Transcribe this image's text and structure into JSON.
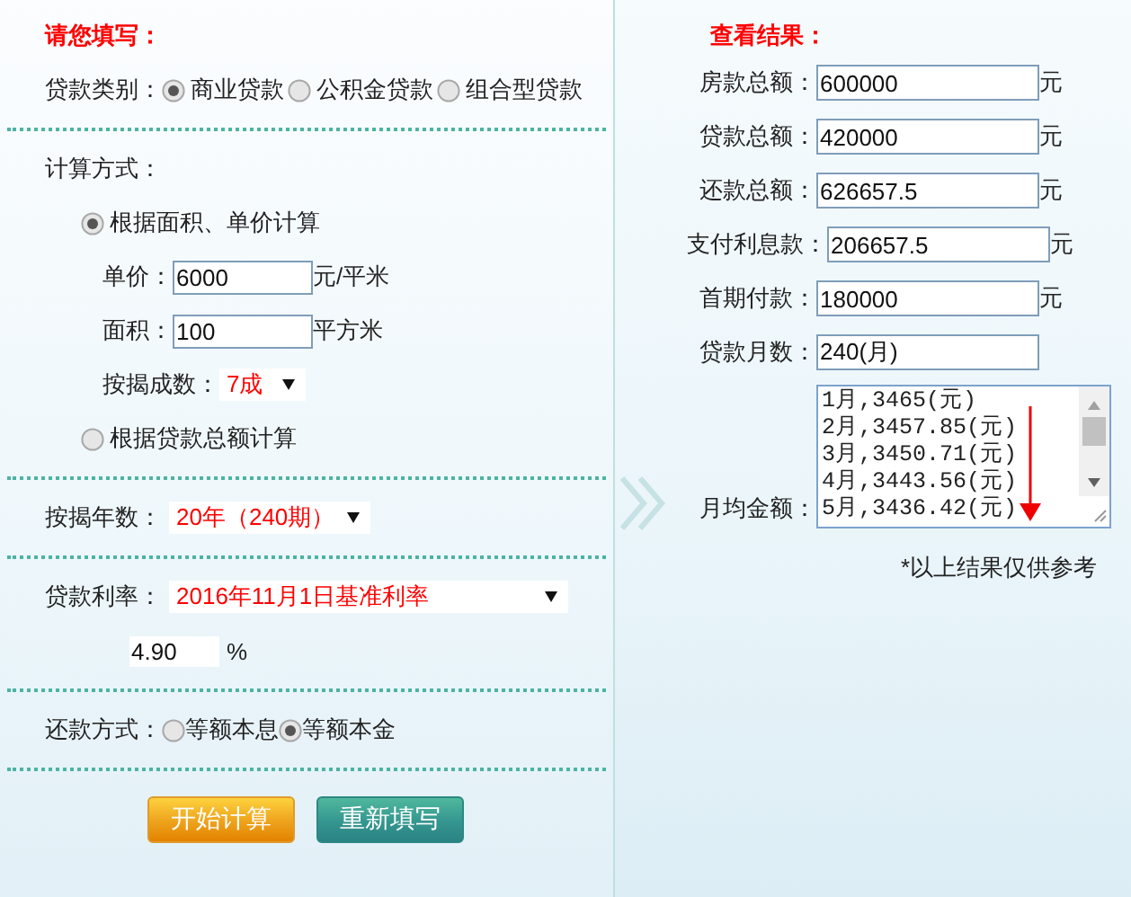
{
  "form": {
    "title": "请您填写：",
    "loan_type": {
      "label": "贷款类别：",
      "options": [
        {
          "label": "商业贷款",
          "selected": true
        },
        {
          "label": "公积金贷款",
          "selected": false
        },
        {
          "label": "组合型贷款",
          "selected": false
        }
      ]
    },
    "calc_method": {
      "label": "计算方式：",
      "by_area": {
        "label": "根据面积、单价计算",
        "selected": true,
        "unit_price": {
          "label": "单价：",
          "value": "6000",
          "unit": "元/平米"
        },
        "area": {
          "label": "面积：",
          "value": "100",
          "unit": "平方米"
        },
        "down_ratio": {
          "label": "按揭成数：",
          "value": "7成"
        }
      },
      "by_total": {
        "label": "根据贷款总额计算",
        "selected": false
      }
    },
    "years": {
      "label": "按揭年数：",
      "value": "20年（240期）"
    },
    "rate": {
      "label": "贷款利率：",
      "value": "2016年11月1日基准利率",
      "rate_value": "4.90",
      "unit": "%"
    },
    "repay": {
      "label": "还款方式：",
      "options": [
        {
          "label": "等额本息",
          "selected": false
        },
        {
          "label": "等额本金",
          "selected": true
        }
      ]
    },
    "buttons": [
      {
        "label": "开始计算",
        "kind": "primary"
      },
      {
        "label": "重新填写",
        "kind": "secondary"
      }
    ]
  },
  "results": {
    "title": "查看结果：",
    "fields": [
      {
        "label": "房款总额：",
        "value": "600000",
        "unit": "元"
      },
      {
        "label": "贷款总额：",
        "value": "420000",
        "unit": "元"
      },
      {
        "label": "还款总额：",
        "value": "626657.5",
        "unit": "元"
      },
      {
        "label": "支付利息款：",
        "value": "206657.5",
        "unit": "元"
      },
      {
        "label": "首期付款：",
        "value": "180000",
        "unit": "元"
      },
      {
        "label": "贷款月数：",
        "value": "240(月)"
      }
    ],
    "monthly": {
      "label": "月均金额：",
      "lines": [
        "1月,3465(元)",
        "2月,3457.85(元)",
        "3月,3450.71(元)",
        "4月,3443.56(元)",
        "5月,3436.42(元)"
      ]
    },
    "note": "*以上结果仅供参考"
  }
}
